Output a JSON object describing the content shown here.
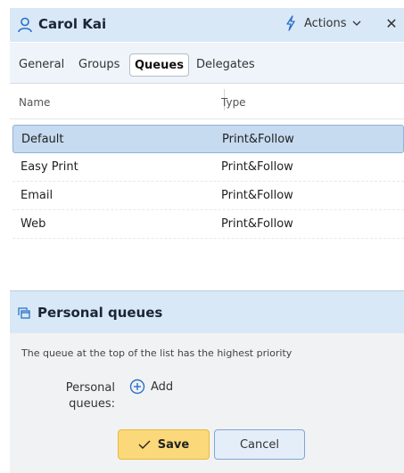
{
  "header": {
    "title": "Carol Kai",
    "user_icon": "user-icon",
    "actions_label": "Actions",
    "actions_icon": "lightning-icon",
    "close_label": "✕"
  },
  "tabs": [
    {
      "label": "General",
      "active": false
    },
    {
      "label": "Groups",
      "active": false
    },
    {
      "label": "Queues",
      "active": true
    },
    {
      "label": "Delegates",
      "active": false
    }
  ],
  "table": {
    "columns": [
      "Name",
      "Type"
    ],
    "rows": [
      {
        "name": "Default",
        "type": "Print&Follow",
        "selected": true
      },
      {
        "name": "Easy Print",
        "type": "Print&Follow",
        "selected": false
      },
      {
        "name": "Email",
        "type": "Print&Follow",
        "selected": false
      },
      {
        "name": "Web",
        "type": "Print&Follow",
        "selected": false
      }
    ]
  },
  "personal_queues": {
    "title": "Personal queues",
    "icon": "copy-windows-icon",
    "hint": "The queue at the top of the list has the highest priority",
    "field_label": "Personal queues:",
    "add_label": "Add"
  },
  "footer": {
    "save_label": "Save",
    "cancel_label": "Cancel"
  },
  "colors": {
    "header_bg": "#d9e8f7",
    "selected_row": "#c6daf0",
    "save_button": "#fbd97a",
    "accent_blue": "#2a6fc9"
  }
}
